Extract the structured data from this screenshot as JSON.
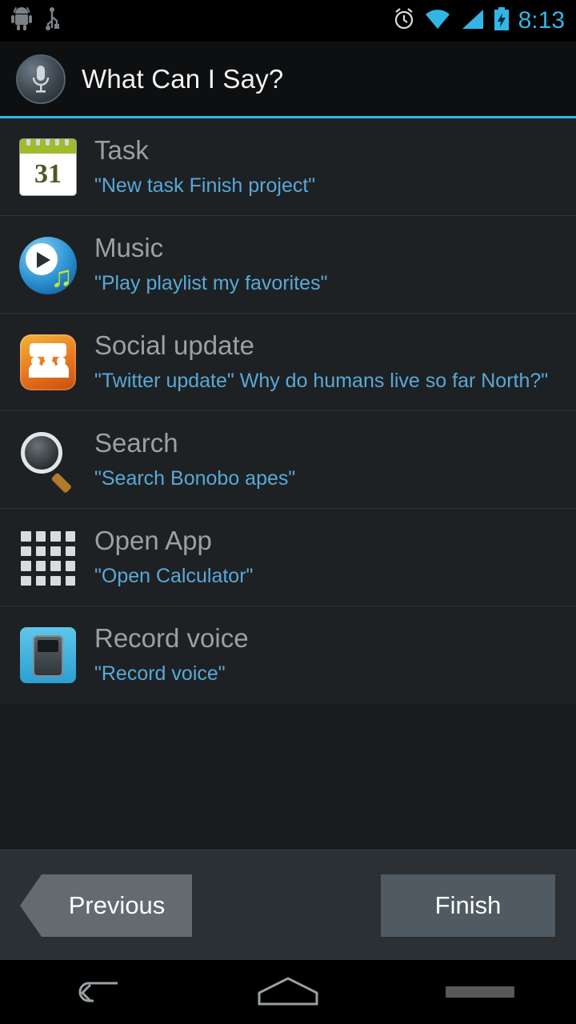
{
  "status_bar": {
    "clock": "8:13",
    "icons_left": [
      "android-robot-icon",
      "usb-icon"
    ],
    "icons_right": [
      "alarm-clock-icon",
      "wifi-icon",
      "cellular-signal-icon",
      "battery-charging-icon"
    ],
    "accent_color": "#33b5e5"
  },
  "title_bar": {
    "icon": "microphone-icon",
    "title": "What Can I Say?"
  },
  "list": {
    "items": [
      {
        "icon": "calendar-icon",
        "calendar_day": "31",
        "title": "Task",
        "example": "\"New task Finish project\""
      },
      {
        "icon": "music-icon",
        "title": "Music",
        "example": "\"Play playlist my favorites\""
      },
      {
        "icon": "social-update-icon",
        "title": "Social update",
        "example": "\"Twitter update\" Why do humans live so far North?\""
      },
      {
        "icon": "search-icon",
        "title": "Search",
        "example": "\"Search Bonobo apes\""
      },
      {
        "icon": "app-grid-icon",
        "title": "Open App",
        "example": "\"Open Calculator\""
      },
      {
        "icon": "voice-recorder-icon",
        "title": "Record voice",
        "example": "\"Record voice\""
      }
    ]
  },
  "footer": {
    "previous_label": "Previous",
    "finish_label": "Finish"
  },
  "nav_bar": {
    "back_label": "back-icon",
    "home_label": "home-icon",
    "recents_label": "recent-apps-icon"
  }
}
